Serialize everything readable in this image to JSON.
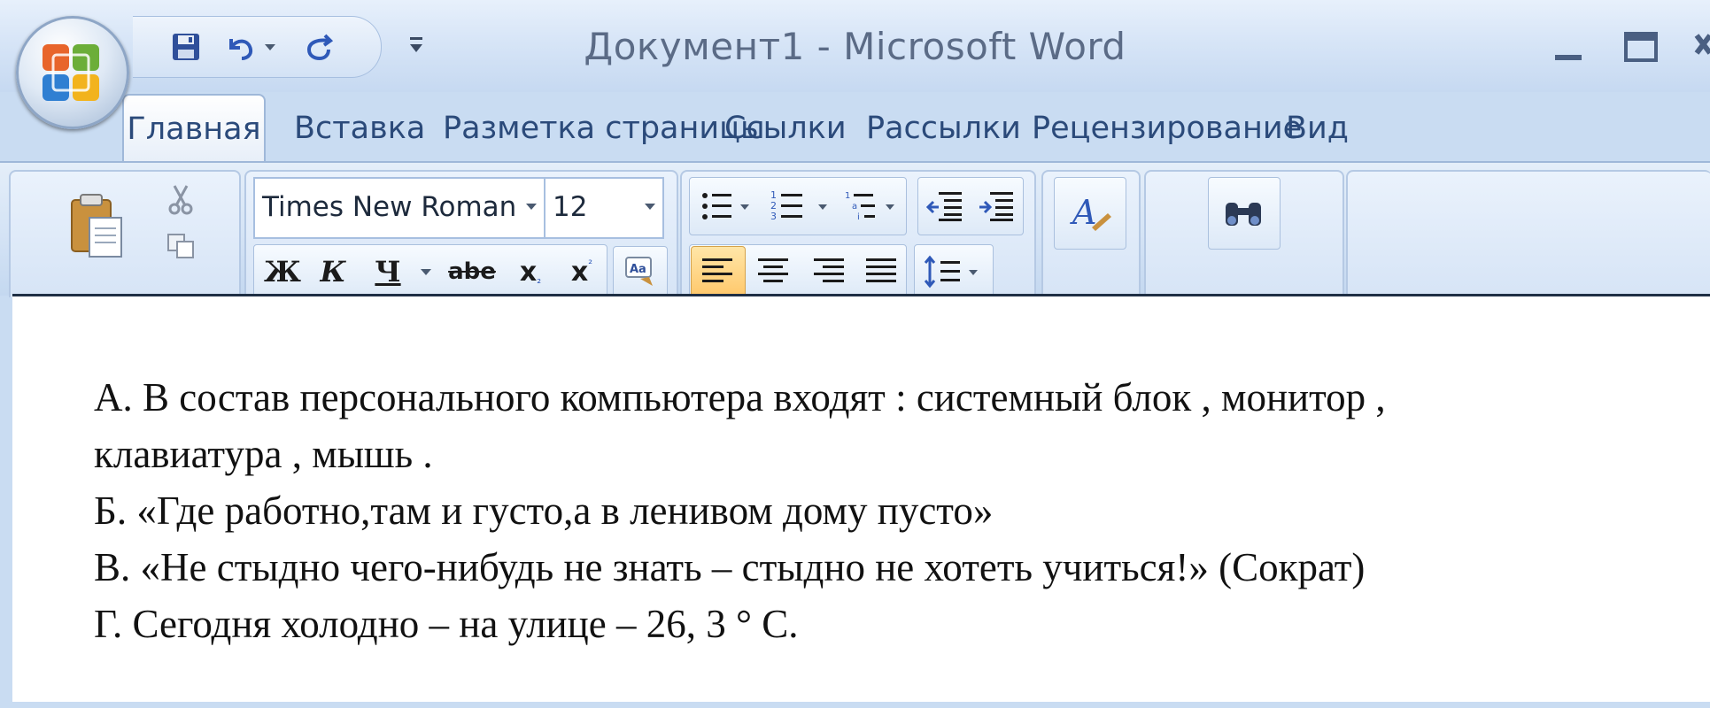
{
  "window": {
    "title": "Документ1 - Microsoft Word"
  },
  "quick_access": {
    "icons": [
      "save-icon",
      "undo-icon",
      "redo-icon",
      "customize-icon"
    ]
  },
  "tabs": [
    {
      "label": "Главная",
      "active": true
    },
    {
      "label": "Вставка"
    },
    {
      "label": "Разметка страницы"
    },
    {
      "label": "Ссылки"
    },
    {
      "label": "Рассылки"
    },
    {
      "label": "Рецензирование"
    },
    {
      "label": "Вид"
    }
  ],
  "ribbon": {
    "font": {
      "name": "Times New Roman",
      "size": "12"
    },
    "format_buttons": {
      "bold": "Ж",
      "italic": "К",
      "underline": "Ч",
      "strike": "abe",
      "subscript": "x",
      "superscript": "x"
    },
    "paragraph": {
      "alignment": "left"
    }
  },
  "colors": {
    "accent": "#2b4a7a",
    "ribbon_bg": "#d4e3f5",
    "active_align": "#ffc86b"
  },
  "document": {
    "lines": [
      "А. В состав персонального компьютера входят : системный блок , монитор ,",
      "клавиатура , мышь  .",
      "Б. «Где работно,там и густо,а в ленивом дому пусто»",
      "В. «Не стыдно чего-нибудь не знать – стыдно не хотеть учиться!» (Сократ)",
      "Г. Сегодня холодно – на улице – 26, 3 ° С."
    ]
  }
}
